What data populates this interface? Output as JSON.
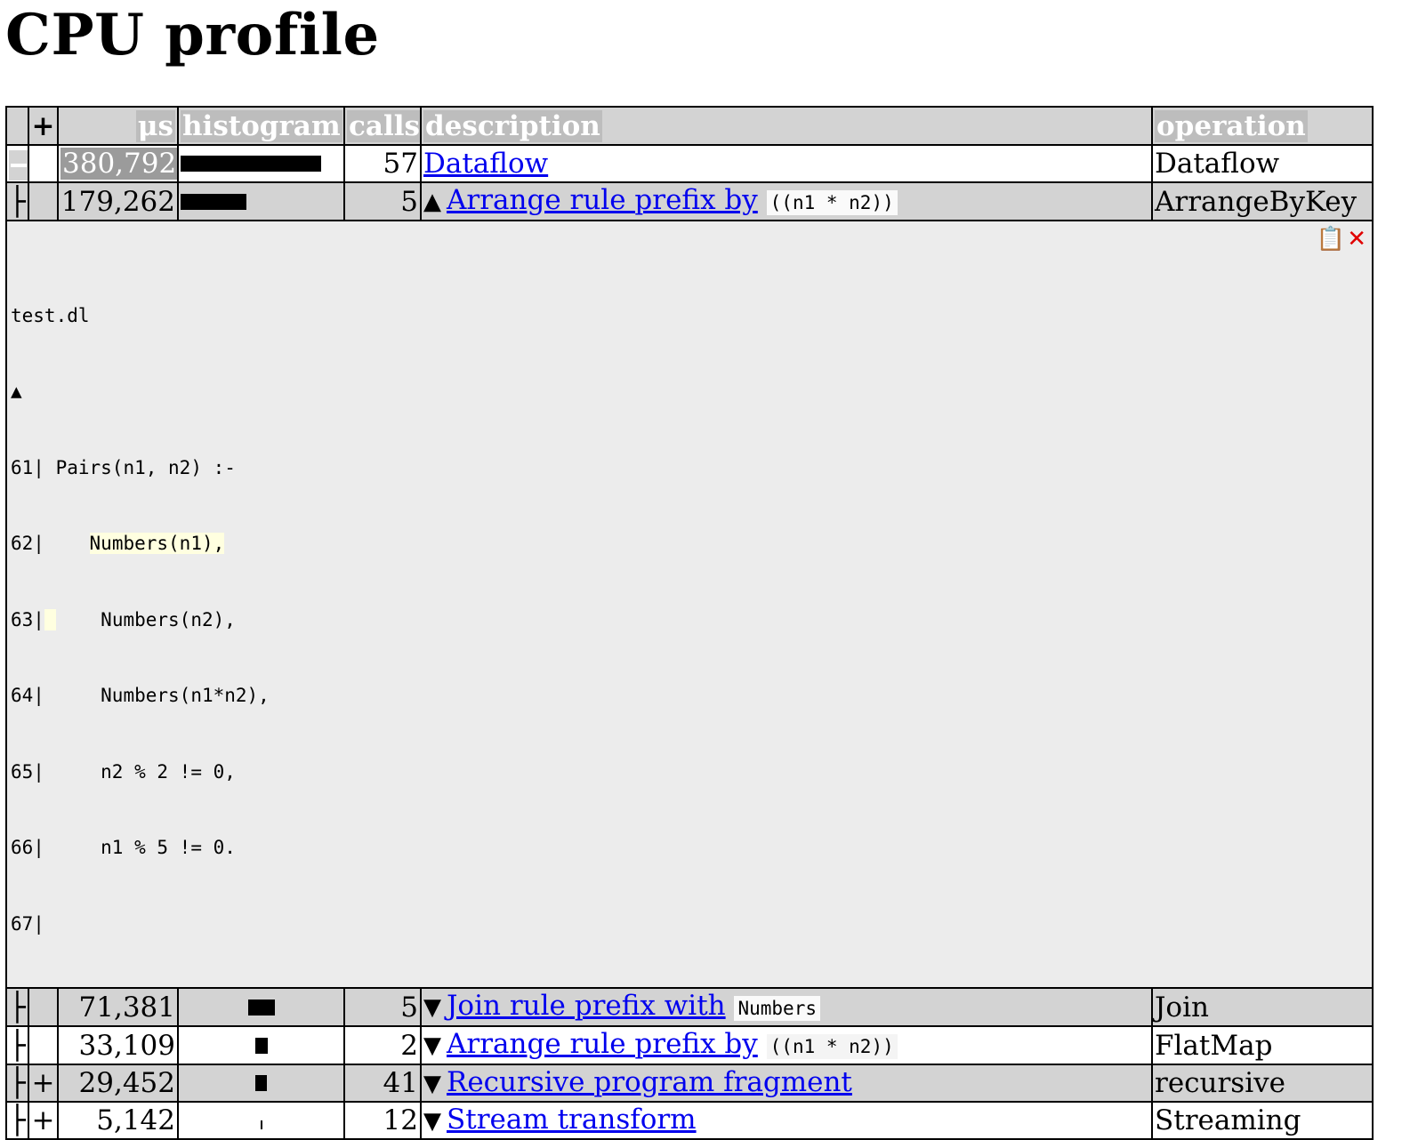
{
  "page": {
    "title": "CPU profile"
  },
  "table": {
    "headers": {
      "expand": "+",
      "us": "μs",
      "histogram": "histogram",
      "calls": "calls",
      "description": "description",
      "operation": "operation"
    },
    "rows": [
      {
        "tree": "",
        "us": "380,792",
        "histogram_fraction": 1.0,
        "calls": "57",
        "arrow": "",
        "link": "Dataflow",
        "code": "",
        "operation": "Dataflow"
      },
      {
        "tree": "├",
        "us": "179,262",
        "histogram_fraction": 0.47,
        "calls": "5",
        "arrow": "▲",
        "link": "Arrange rule prefix by",
        "code": "((n1 * n2))",
        "operation": "ArrangeByKey"
      },
      {
        "tree": "├",
        "us": "71,381",
        "histogram_fraction": 0.19,
        "calls": "5",
        "arrow": "▼",
        "link": "Join rule prefix with",
        "code": "Numbers",
        "operation": "Join"
      },
      {
        "tree": "├",
        "us": "33,109",
        "histogram_fraction": 0.09,
        "calls": "2",
        "arrow": "▼",
        "link": "Arrange rule prefix by",
        "code": "((n1 * n2))",
        "operation": "FlatMap"
      },
      {
        "tree": "├",
        "expand": "+",
        "us": "29,452",
        "histogram_fraction": 0.08,
        "calls": "41",
        "arrow": "▼",
        "link": "Recursive program fragment",
        "code": "",
        "operation": "recursive"
      },
      {
        "tree": "├",
        "expand": "+",
        "us": "5,142",
        "histogram_fraction": 0.014,
        "calls": "12",
        "arrow": "▼",
        "link": "Stream transform",
        "code": "",
        "operation": "Streaming"
      }
    ],
    "source": {
      "filename": "test.dl",
      "arrow": "▲",
      "lines": [
        {
          "num": "61",
          "text": " Pairs(n1, n2) :-"
        },
        {
          "num": "62",
          "text": "     Numbers(n1),"
        },
        {
          "num": "63",
          "text": "     Numbers(n2),"
        },
        {
          "num": "64",
          "text": "     Numbers(n1*n2),"
        },
        {
          "num": "65",
          "text": "     n2 % 2 != 0,"
        },
        {
          "num": "66",
          "text": "     n1 % 5 != 0."
        },
        {
          "num": "67",
          "text": ""
        }
      ],
      "copy_icon": "📋",
      "close_icon": "✕"
    }
  },
  "colors": {
    "link": "#0000ee",
    "header_bg": "#d3d3d3",
    "stripe": "#d3d3d3",
    "source_bg": "#ececec",
    "highlight": "#ffffe0",
    "close": "#e00000"
  }
}
